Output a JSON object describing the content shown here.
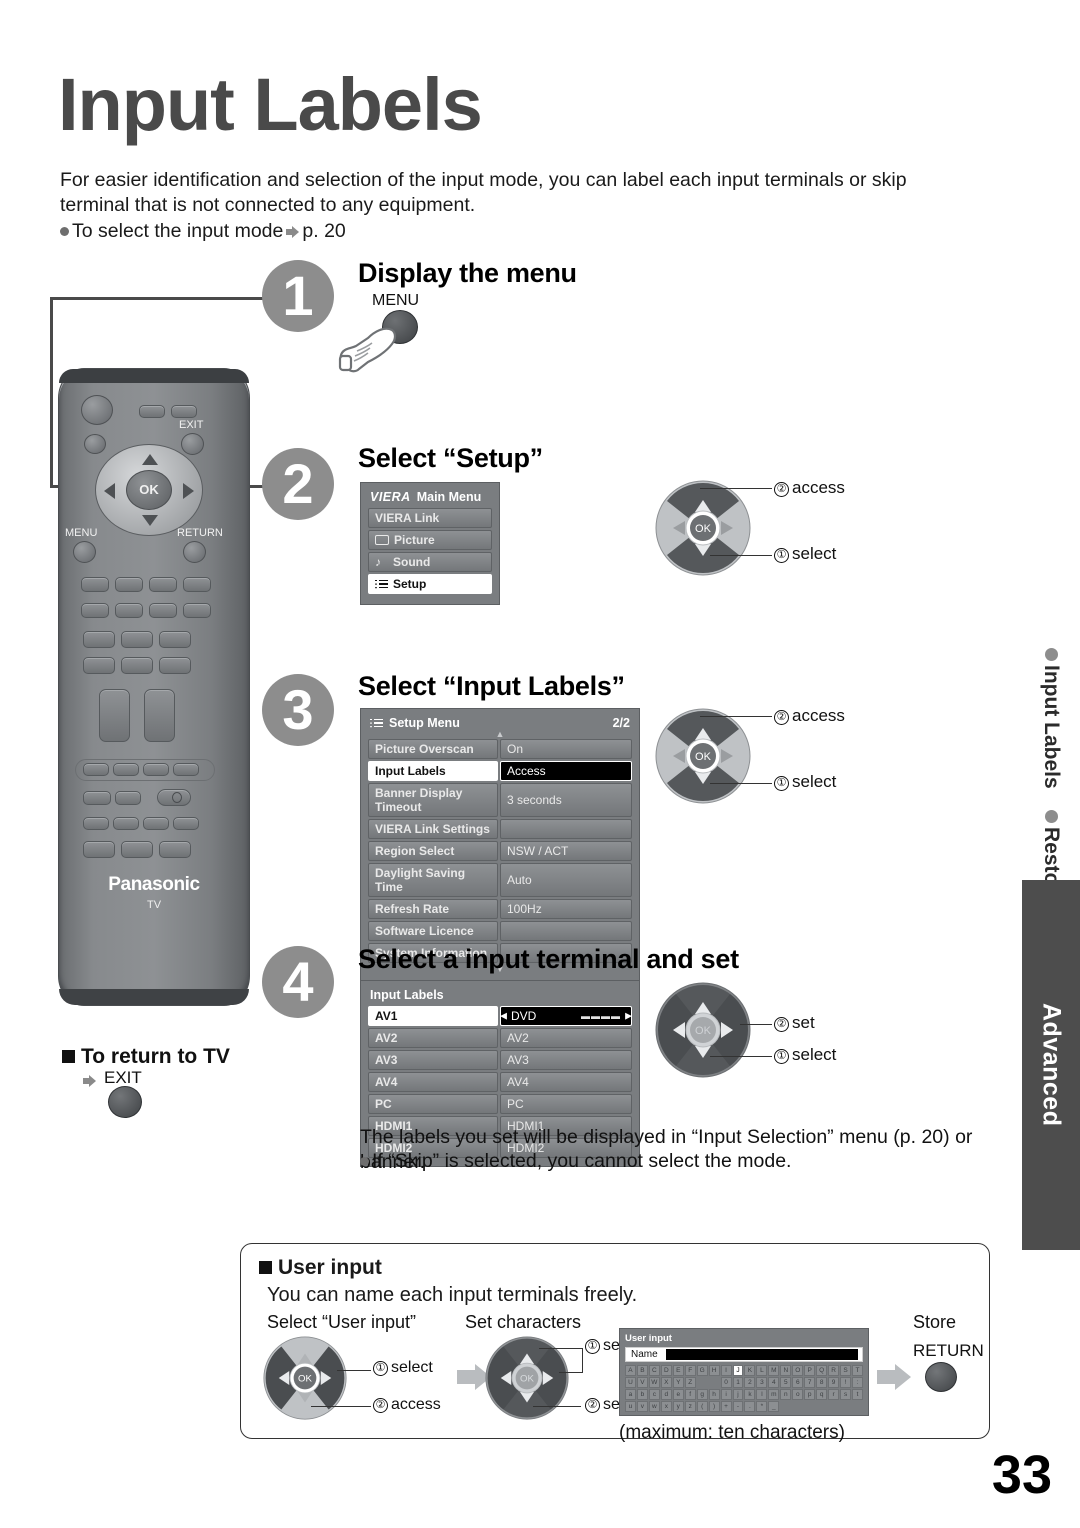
{
  "page": {
    "title": "Input Labels",
    "number": "33",
    "intro_line1": "For easier identification and selection of the input mode, you can label each input terminals or skip",
    "intro_line2": "terminal that is not connected to any equipment.",
    "intro_bullet": "To select the input mode",
    "intro_bullet_ref": "p. 20"
  },
  "sidebar": {
    "tab_items": [
      "Input Labels",
      "Restore Settings"
    ],
    "section_tab": "Advanced"
  },
  "remote": {
    "brand": "Panasonic",
    "model_label": "TV",
    "buttons": {
      "menu": "MENU",
      "exit": "EXIT",
      "return": "RETURN",
      "ok": "OK"
    }
  },
  "steps": [
    {
      "number": "1",
      "heading": "Display the menu",
      "button_label": "MENU"
    },
    {
      "number": "2",
      "heading": "Select “Setup”",
      "callouts": [
        {
          "num": "②",
          "label": "access"
        },
        {
          "num": "①",
          "label": "select"
        }
      ]
    },
    {
      "number": "3",
      "heading": "Select “Input Labels”",
      "callouts": [
        {
          "num": "②",
          "label": "access"
        },
        {
          "num": "①",
          "label": "select"
        }
      ]
    },
    {
      "number": "4",
      "heading": "Select a input terminal and set",
      "callouts": [
        {
          "num": "②",
          "label": "set"
        },
        {
          "num": "①",
          "label": "select"
        }
      ]
    }
  ],
  "main_menu": {
    "logo": "VIERA",
    "title": "Main Menu",
    "items": [
      {
        "label": "VIERA Link",
        "icon": "none",
        "selected": false
      },
      {
        "label": "Picture",
        "icon": "picture-icon",
        "selected": false
      },
      {
        "label": "Sound",
        "icon": "note-icon",
        "selected": false
      },
      {
        "label": "Setup",
        "icon": "list-icon",
        "selected": true
      }
    ]
  },
  "setup_menu": {
    "title": "Setup Menu",
    "icon": "list-icon",
    "page_indicator": "2/2",
    "rows": [
      {
        "label": "Picture Overscan",
        "value": "On",
        "selected": false
      },
      {
        "label": "Input Labels",
        "value": "Access",
        "selected": true
      },
      {
        "label": "Banner Display Timeout",
        "value": "3 seconds",
        "selected": false
      },
      {
        "label": "VIERA Link Settings",
        "value": "",
        "selected": false
      },
      {
        "label": "Region Select",
        "value": "NSW / ACT",
        "selected": false
      },
      {
        "label": "Daylight Saving Time",
        "value": "Auto",
        "selected": false
      },
      {
        "label": "Refresh Rate",
        "value": "100Hz",
        "selected": false
      },
      {
        "label": "Software Licence",
        "value": "",
        "selected": false
      },
      {
        "label": "System Information",
        "value": "",
        "selected": false
      }
    ]
  },
  "input_labels_menu": {
    "title": "Input Labels",
    "rows": [
      {
        "label": "AV1",
        "value": "DVD",
        "selected": true
      },
      {
        "label": "AV2",
        "value": "AV2",
        "selected": false
      },
      {
        "label": "AV3",
        "value": "AV3",
        "selected": false
      },
      {
        "label": "AV4",
        "value": "AV4",
        "selected": false
      },
      {
        "label": "PC",
        "value": "PC",
        "selected": false
      },
      {
        "label": "HDMI1",
        "value": "HDMI1",
        "selected": false
      },
      {
        "label": "HDMI2",
        "value": "HDMI2",
        "selected": false
      }
    ]
  },
  "return_to_tv": {
    "heading": "To return to TV",
    "button_label": "EXIT"
  },
  "notes": {
    "line1": "The labels you set will be displayed in “Input Selection” menu (p. 20) or banner.",
    "line2": "If “Skip” is selected, you cannot select the mode."
  },
  "user_input": {
    "heading": "User input",
    "subheading": "You can name each input terminals freely.",
    "col1_caption": "Select “User input”",
    "col2_caption": "Set characters",
    "col3_caption": "Store",
    "store_button": "RETURN",
    "maximum_note": "(maximum: ten characters)",
    "wheel1": [
      {
        "num": "①",
        "label": "select"
      },
      {
        "num": "②",
        "label": "access"
      }
    ],
    "wheel2": [
      {
        "num": "①",
        "label": "select"
      },
      {
        "num": "②",
        "label": "set"
      }
    ],
    "keypad": {
      "title": "User input",
      "name_label": "Name",
      "rows": [
        [
          "A",
          "B",
          "C",
          "D",
          "E",
          "F",
          "G",
          "H",
          "I",
          "J",
          "K",
          "L",
          "M",
          "N",
          "O",
          "P",
          "Q",
          "R",
          "S",
          "T"
        ],
        [
          "U",
          "V",
          "W",
          "X",
          "Y",
          "Z",
          "",
          "",
          "0",
          "1",
          "2",
          "3",
          "4",
          "5",
          "6",
          "7",
          "8",
          "9",
          "!",
          ":"
        ],
        [
          "a",
          "b",
          "c",
          "d",
          "e",
          "f",
          "g",
          "h",
          "i",
          "j",
          "k",
          "l",
          "m",
          "n",
          "o",
          "p",
          "q",
          "r",
          "s",
          "t"
        ],
        [
          "u",
          "v",
          "w",
          "x",
          "y",
          "z",
          "(",
          ")",
          "+",
          "-",
          ".",
          "*",
          "_",
          "",
          "",
          "",
          "",
          "",
          "",
          ""
        ]
      ],
      "selected": "J"
    }
  },
  "colors": {
    "title_gray": "#4a4a4a",
    "step_circle": "#8d8d8d",
    "osd_bg": "#7a7d80",
    "advanced_tab": "#4d4d4d",
    "highlight": "#000000"
  }
}
